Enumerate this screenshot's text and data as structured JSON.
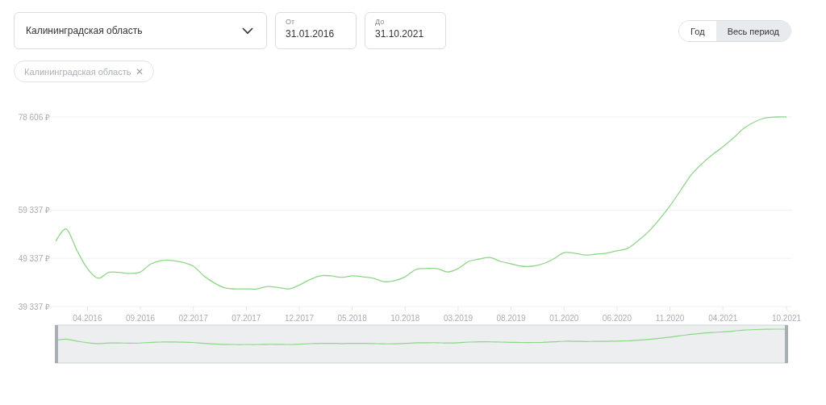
{
  "filters": {
    "region_select": {
      "value": "Калининградская область"
    },
    "date_from": {
      "label": "От",
      "value": "31.01.2016"
    },
    "date_to": {
      "label": "До",
      "value": "31.10.2021"
    },
    "period_toggle": [
      {
        "label": "Год",
        "selected": false
      },
      {
        "label": "Весь период",
        "selected": true
      }
    ],
    "chips": [
      {
        "label": "Калининградская область",
        "close": "✕"
      }
    ]
  },
  "chart": {
    "chart_data": {
      "type": "line",
      "categories": [
        null,
        null,
        null,
        "04.2016",
        null,
        null,
        null,
        null,
        "09.2016",
        null,
        null,
        null,
        null,
        "02.2017",
        null,
        null,
        null,
        null,
        "07.2017",
        null,
        null,
        null,
        null,
        "12.2017",
        null,
        null,
        null,
        null,
        "05.2018",
        null,
        null,
        null,
        null,
        "10.2018",
        null,
        null,
        null,
        null,
        "03.2019",
        null,
        null,
        null,
        null,
        "08.2019",
        null,
        null,
        null,
        null,
        "01.2020",
        null,
        null,
        null,
        null,
        "06.2020",
        null,
        null,
        null,
        null,
        "11.2020",
        null,
        null,
        null,
        null,
        "04.2021",
        null,
        null,
        null,
        null,
        null,
        "10.2021"
      ],
      "series": [
        {
          "color": "#8fd68a",
          "values": [
            52900,
            55400,
            51000,
            47200,
            45200,
            46400,
            46400,
            46200,
            46500,
            48200,
            48900,
            48900,
            48500,
            47700,
            45700,
            44200,
            43200,
            43000,
            43000,
            43000,
            43500,
            43300,
            43000,
            43800,
            44900,
            45700,
            45700,
            45400,
            45700,
            45500,
            45200,
            44500,
            44700,
            45500,
            47000,
            47200,
            47200,
            46500,
            47200,
            48700,
            49200,
            49500,
            48700,
            48200,
            47700,
            47700,
            48200,
            49200,
            50500,
            50400,
            50000,
            50200,
            50400,
            50900,
            51400,
            53000,
            54900,
            57400,
            60200,
            63400,
            66600,
            68900,
            70800,
            72400,
            74300,
            76300,
            77600,
            78400,
            78600,
            78600
          ]
        }
      ],
      "ylim": [
        39337,
        78606
      ],
      "yticks": [
        {
          "value": 39337,
          "label": "39 337 ₽"
        },
        {
          "value": 49337,
          "label": "49 337 ₽"
        },
        {
          "value": 59337,
          "label": "59 337 ₽"
        },
        {
          "value": 78606,
          "label": "78 606 ₽"
        }
      ]
    }
  }
}
